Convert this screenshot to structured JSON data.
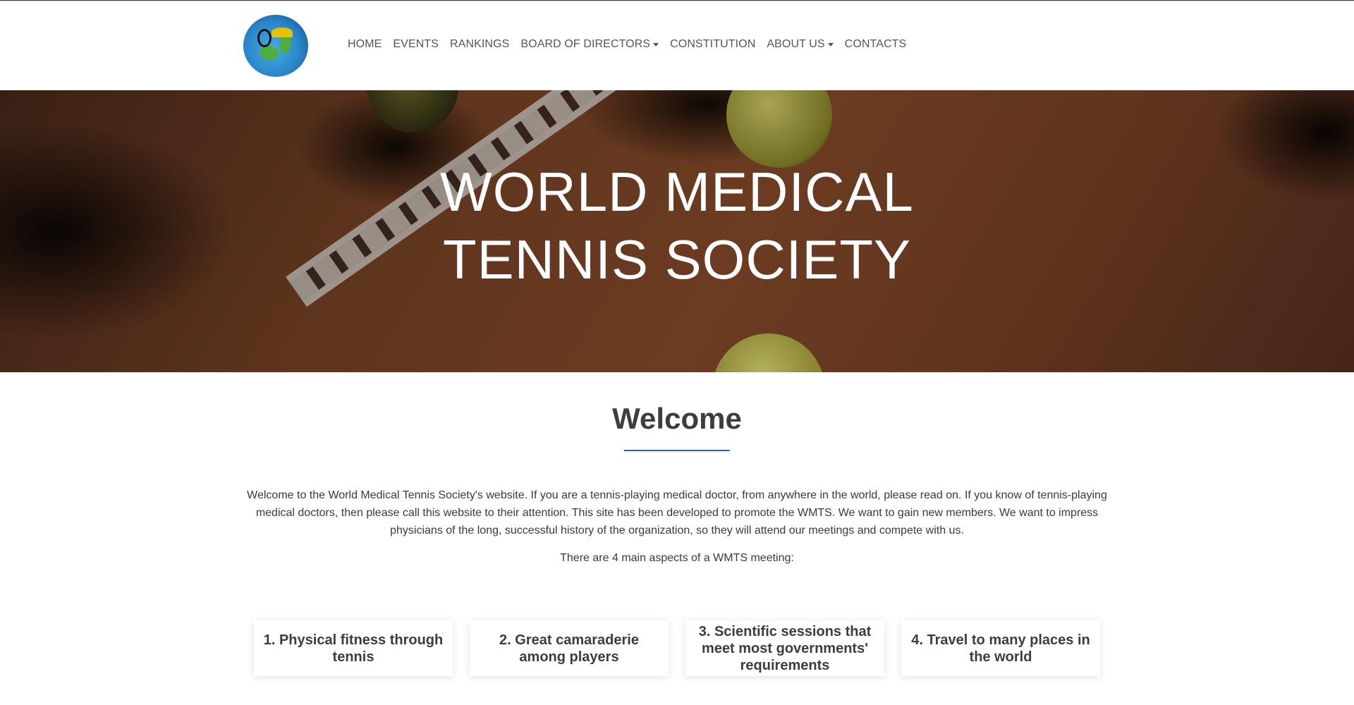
{
  "nav": {
    "logo_alt": "WORLD MEDICAL TENNIS SOCIETY",
    "items": [
      {
        "label": "HOME",
        "dropdown": false
      },
      {
        "label": "EVENTS",
        "dropdown": false
      },
      {
        "label": "RANKINGS",
        "dropdown": false
      },
      {
        "label": "BOARD OF DIRECTORS",
        "dropdown": true
      },
      {
        "label": "CONSTITUTION",
        "dropdown": false
      },
      {
        "label": "ABOUT US",
        "dropdown": true
      },
      {
        "label": "CONTACTS",
        "dropdown": false
      }
    ]
  },
  "hero": {
    "title_line1": "WORLD MEDICAL",
    "title_line2": "TENNIS SOCIETY"
  },
  "welcome": {
    "title": "Welcome",
    "accent_color": "#2f5fae",
    "intro": "Welcome to the World Medical Tennis Society's website. If you are a tennis-playing medical doctor, from anywhere in the world, please read on. If you know of tennis-playing medical doctors, then please call this website to their attention. This site has been developed to promote the WMTS. We want to gain new members. We want to impress physicians of the long, successful history of the organization, so they will attend our meetings and compete with us.",
    "aspects_lead": "There are 4 main aspects of a WMTS meeting:"
  },
  "aspects": [
    "1. Physical fitness through tennis",
    "2. Great camaraderie among players",
    "3. Scientific sessions that meet most governments' requirements",
    "4. Travel to many places in the world"
  ]
}
